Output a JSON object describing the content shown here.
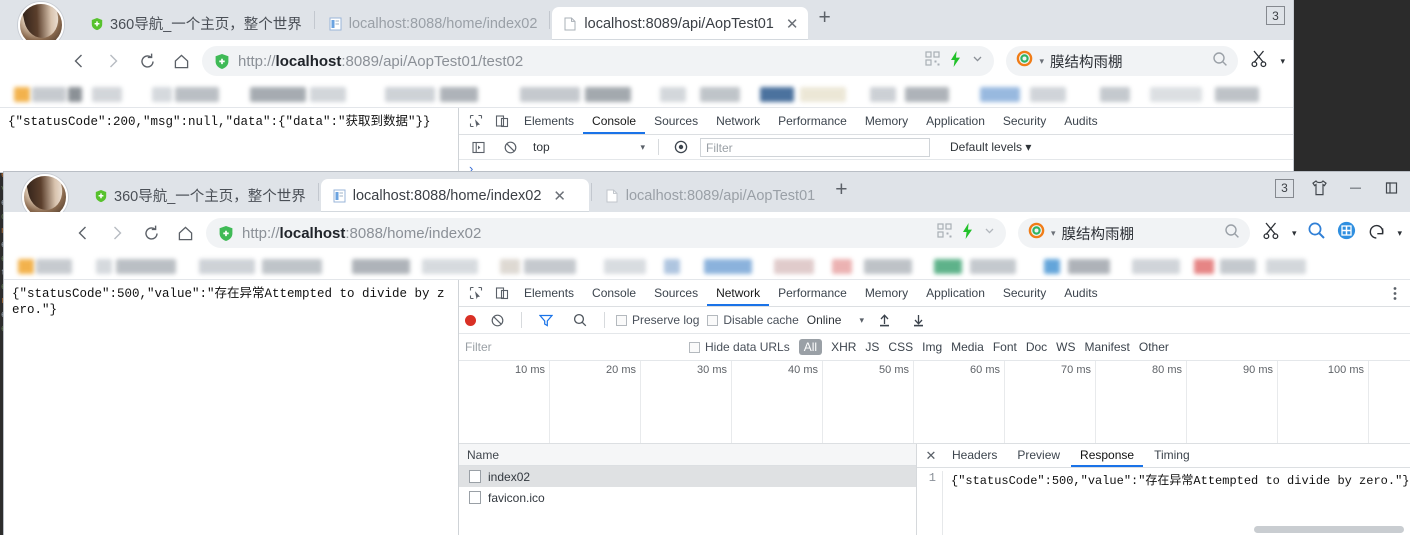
{
  "window_top": {
    "tabs": [
      {
        "title": "360导航_一个主页，整个世界",
        "state": "inactive",
        "favicon": "360-shield-icon"
      },
      {
        "title": "localhost:8088/home/index02",
        "state": "inactive",
        "favicon": "page-icon"
      },
      {
        "title": "localhost:8089/api/AopTest01",
        "state": "active",
        "favicon": "page-icon"
      }
    ],
    "new_tab_label": "+",
    "tab_count": "3",
    "toolbar": {
      "back": "‹",
      "forward": "›",
      "reload": "⟳",
      "home": "⌂",
      "url_prefix": "http://",
      "url_host": "localhost",
      "url_rest": ":8089/api/AopTest01/test02",
      "search_value": "膜结构雨棚"
    },
    "page_content": "{\"statusCode\":200,\"msg\":null,\"data\":{\"data\":\"获取到数据\"}}",
    "devtools": {
      "tabs": [
        "Elements",
        "Console",
        "Sources",
        "Network",
        "Performance",
        "Memory",
        "Application",
        "Security",
        "Audits"
      ],
      "active_tab": "Console",
      "console": {
        "context": "top",
        "filter_placeholder": "Filter",
        "levels_label": "Default levels",
        "prompt": "›"
      }
    }
  },
  "window_bottom": {
    "tabs": [
      {
        "title": "360导航_一个主页，整个世界",
        "state": "inactive",
        "favicon": "360-shield-icon"
      },
      {
        "title": "localhost:8088/home/index02",
        "state": "active",
        "favicon": "page-icon"
      },
      {
        "title": "localhost:8089/api/AopTest01",
        "state": "inactive",
        "favicon": "page-icon"
      }
    ],
    "new_tab_label": "+",
    "tab_count": "3",
    "window_controls": {
      "skin": "shirt-icon",
      "minimize": "−",
      "maximize": "▫"
    },
    "toolbar": {
      "back": "‹",
      "forward": "›",
      "reload": "⟳",
      "home": "⌂",
      "url_prefix": "http://",
      "url_host": "localhost",
      "url_rest": ":8088/home/index02",
      "search_value": "膜结构雨棚"
    },
    "page_content": "{\"statusCode\":500,\"value\":\"存在异常Attempted to divide by zero.\"}",
    "devtools": {
      "tabs": [
        "Elements",
        "Console",
        "Sources",
        "Network",
        "Performance",
        "Memory",
        "Application",
        "Security",
        "Audits"
      ],
      "active_tab": "Network",
      "network": {
        "preserve_log": "Preserve log",
        "disable_cache": "Disable cache",
        "throttling": "Online",
        "filter_placeholder": "Filter",
        "hide_data_urls": "Hide data URLs",
        "types": [
          "All",
          "XHR",
          "JS",
          "CSS",
          "Img",
          "Media",
          "Font",
          "Doc",
          "WS",
          "Manifest",
          "Other"
        ],
        "selected_type": "All",
        "timeline_ticks": [
          "10 ms",
          "20 ms",
          "30 ms",
          "40 ms",
          "50 ms",
          "60 ms",
          "70 ms",
          "80 ms",
          "90 ms",
          "100 ms"
        ],
        "name_column": "Name",
        "requests": [
          {
            "name": "index02",
            "selected": true
          },
          {
            "name": "favicon.ico",
            "selected": false
          }
        ],
        "detail_tabs": [
          "Headers",
          "Preview",
          "Response",
          "Timing"
        ],
        "detail_active": "Response",
        "response_line_number": "1",
        "response_body": "{\"statusCode\":500,\"value\":\"存在异常Attempted to divide by zero.\"}"
      }
    }
  },
  "colors": {
    "accent": "#1a73e8",
    "record": "#d93025",
    "tabstrip": "#dfe3e8",
    "desktop": "#2b2b2b"
  }
}
